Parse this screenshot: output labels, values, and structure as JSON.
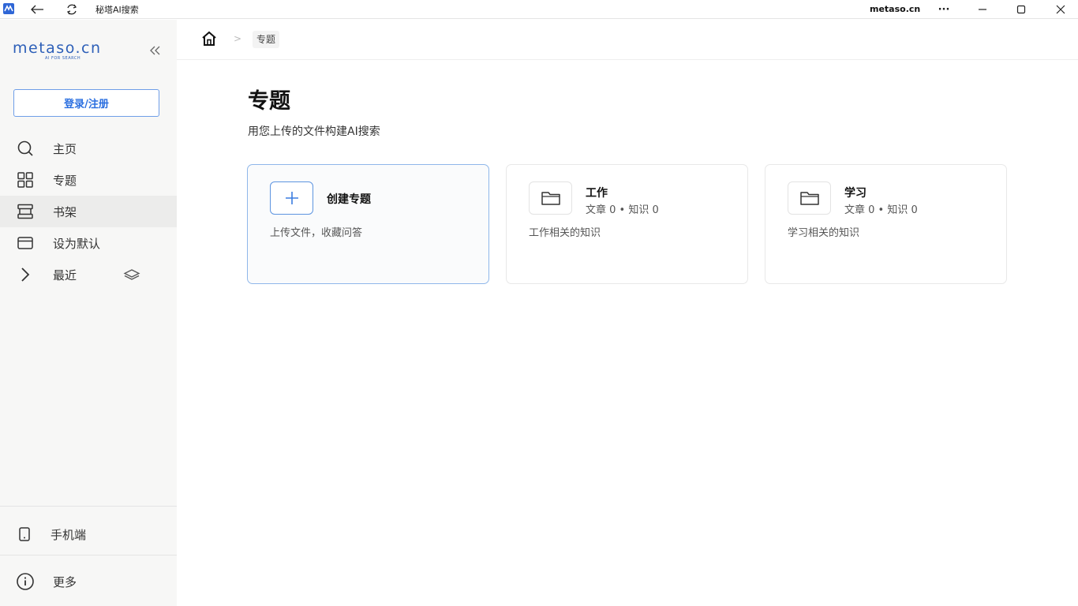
{
  "titlebar": {
    "app_title": "秘塔AI搜索",
    "domain": "metaso.cn",
    "more_label": "···"
  },
  "sidebar": {
    "logo_text": "metaso.cn",
    "logo_tagline": "AI FOR SEARCH",
    "login_label": "登录/注册",
    "items": [
      {
        "label": "主页",
        "icon": "search-icon"
      },
      {
        "label": "专题",
        "icon": "grid-icon"
      },
      {
        "label": "书架",
        "icon": "bookshelf-icon"
      },
      {
        "label": "设为默认",
        "icon": "window-icon"
      },
      {
        "label": "最近",
        "icon": "chevron-right-icon"
      }
    ],
    "mobile_label": "手机端",
    "more_label": "更多"
  },
  "breadcrumb": {
    "separator": ">",
    "current": "专题"
  },
  "main": {
    "title": "专题",
    "subtitle": "用您上传的文件构建AI搜索",
    "create_card": {
      "title": "创建专题",
      "desc": "上传文件，收藏问答"
    },
    "cards": [
      {
        "title": "工作",
        "meta": "文章 0 • 知识 0",
        "desc": "工作相关的知识"
      },
      {
        "title": "学习",
        "meta": "文章 0 • 知识 0",
        "desc": "学习相关的知识"
      }
    ]
  },
  "colors": {
    "accent": "#2b6fe0",
    "sidebar_bg": "#f7f7f6",
    "active_bg": "#ececeb"
  }
}
